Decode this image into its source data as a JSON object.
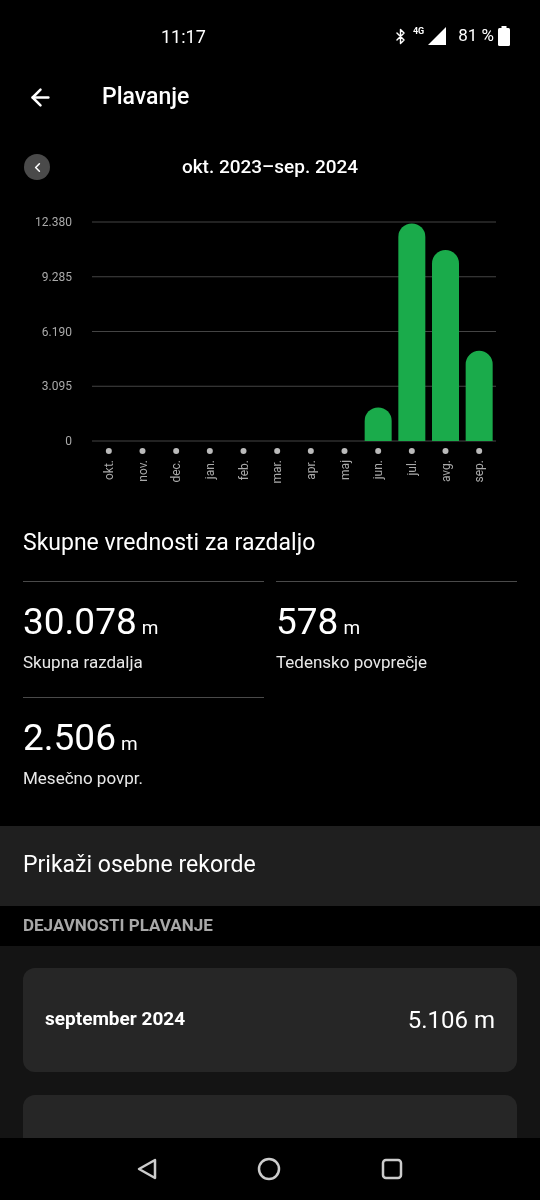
{
  "status_bar": {
    "time": "11:17",
    "network": "4G",
    "battery": "81 %"
  },
  "header": {
    "title": "Plavanje"
  },
  "period": {
    "label": "okt. 2023–sep. 2024"
  },
  "chart": {
    "chart_data": {
      "type": "bar",
      "categories": [
        "okt.",
        "nov.",
        "dec.",
        "jan.",
        "feb.",
        "mar.",
        "apr.",
        "maj",
        "jun.",
        "jul.",
        "avg.",
        "sep."
      ],
      "grid": true,
      "series": [
        {
          "color": "#1aab4b",
          "values": [
            0,
            0,
            0,
            0,
            0,
            0,
            0,
            0,
            1900,
            12300,
            10800,
            5100
          ]
        }
      ],
      "ylim": [
        0,
        12380
      ],
      "yticks": [
        {
          "value": 0,
          "label": "0"
        },
        {
          "value": 3095,
          "label": "3.095"
        },
        {
          "value": 6190,
          "label": "6.190"
        },
        {
          "value": 9285,
          "label": "9.285"
        },
        {
          "value": 12380,
          "label": "12.380"
        }
      ]
    }
  },
  "totals": {
    "title": "Skupne vrednosti za razdaljo",
    "stats": [
      {
        "value": "30.078",
        "unit": "m",
        "label": "Skupna razdalja"
      },
      {
        "value": "578",
        "unit": "m",
        "label": "Tedensko povprečje"
      },
      {
        "value": "2.506",
        "unit": "m",
        "label": "Mesečno povpr."
      }
    ]
  },
  "records_button": "Prikaži osebne rekorde",
  "activities": {
    "title": "DEJAVNOSTI PLAVANJE",
    "items": [
      {
        "month": "september 2024",
        "distance": "5.106 m"
      }
    ]
  }
}
